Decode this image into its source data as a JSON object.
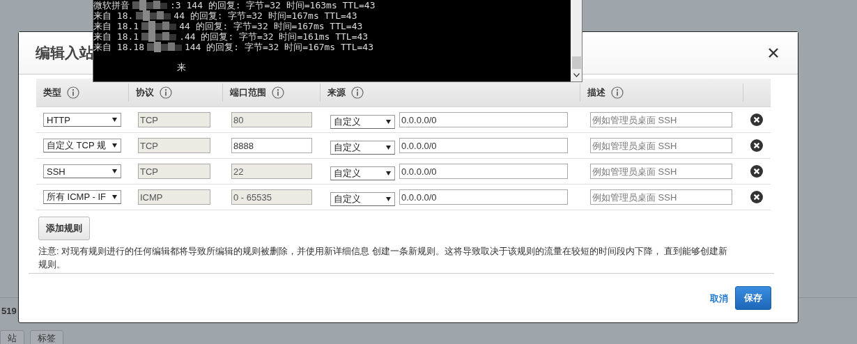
{
  "page": {
    "count": "519",
    "tabs": [
      {
        "label": "站",
        "selected": false
      },
      {
        "label": "标签",
        "selected": false
      }
    ]
  },
  "console": {
    "lines": [
      {
        "prefix": "微软拼音",
        "suffix": ":3 144 的回复: 字节=32 时间=163ms TTL=43"
      },
      {
        "prefix": "来自 18.",
        "suffix": "44 的回复: 字节=32 时间=167ms TTL=43"
      },
      {
        "prefix": "来自 18.1",
        "suffix": "44 的回复: 字节=32 时间=167ms TTL=43"
      },
      {
        "prefix": "来自 18.1",
        "suffix": ".44 的回复: 字节=32 时间=161ms TTL=43"
      },
      {
        "prefix": "来自 18.18",
        "suffix": "144 的回复: 字节=32 时间=167ms TTL=43"
      }
    ],
    "input_line": "来"
  },
  "dialog": {
    "title": "编辑入站",
    "columns": [
      "类型",
      "协议",
      "端口范围",
      "来源",
      "描述"
    ],
    "rules": [
      {
        "type": "HTTP",
        "protocol": "TCP",
        "port_range": "80",
        "port_disabled": true,
        "source": "自定义",
        "cidr": "0.0.0.0/0",
        "description_placeholder": "例如管理员桌面 SSH"
      },
      {
        "type": "自定义 TCP 规",
        "protocol": "TCP",
        "port_range": "8888",
        "port_disabled": false,
        "source": "自定义",
        "cidr": "0.0.0.0/0",
        "description_placeholder": "例如管理员桌面 SSH"
      },
      {
        "type": "SSH",
        "protocol": "TCP",
        "port_range": "22",
        "port_disabled": true,
        "source": "自定义",
        "cidr": "0.0.0.0/0",
        "description_placeholder": "例如管理员桌面 SSH"
      },
      {
        "type": "所有 ICMP - IF",
        "protocol": "ICMP",
        "port_range": "0 - 65535",
        "port_disabled": true,
        "source": "自定义",
        "cidr": "0.0.0.0/0",
        "description_placeholder": "例如管理员桌面 SSH"
      }
    ],
    "add_button": "添加规则",
    "note": "注意: 对现有规则进行的任何编辑都将导致所编辑的规则被删除，并使用新详细信息 创建一条新规则。这将导致取决于该规则的流量在较短的时间段内下降， 直到能够创建新规则。",
    "cancel": "取消",
    "save": "保存"
  }
}
